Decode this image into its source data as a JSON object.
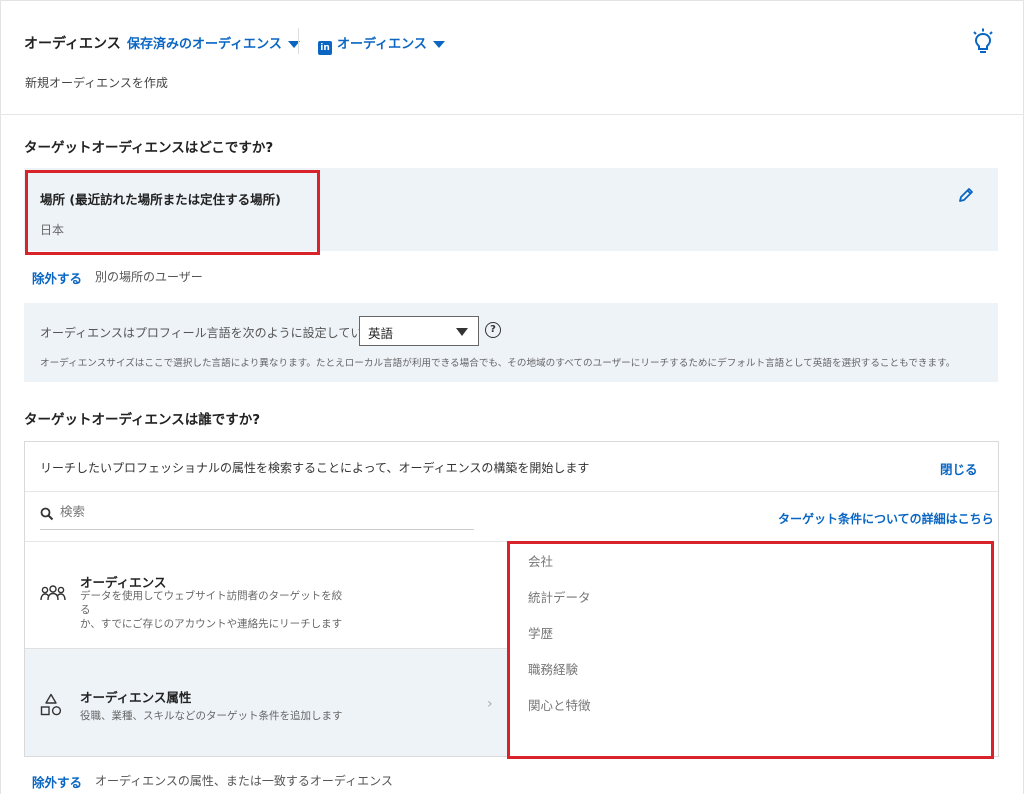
{
  "header": {
    "title": "オーディエンス",
    "saved_dropdown": "保存済みのオーディエンス",
    "linkedin_dropdown": "オーディエンス",
    "linkedin_logo": "in",
    "new_audience": "新規オーディエンスを作成"
  },
  "location": {
    "heading": "ターゲットオーディエンスはどこですか?",
    "title": "場所 (最近訪れた場所または定住する場所)",
    "value": "日本",
    "exclude_label": "除外する",
    "exclude_desc": "別の場所のユーザー"
  },
  "language": {
    "text": "オーディエンスはプロフィール言語を次のように設定しています",
    "selected": "英語",
    "help": "?",
    "note": "オーディエンスサイズはここで選択した言語により異なります。たとえローカル言語が利用できる場合でも、その地域のすべてのユーザーにリーチするためにデフォルト言語として英語を選択することもできます。"
  },
  "who": {
    "heading": "ターゲットオーディエンスは誰ですか?",
    "intro": "リーチしたいプロフェッショナルの属性を検索することによって、オーディエンスの構築を開始します",
    "close": "閉じる",
    "search_placeholder": "検索",
    "details_link": "ターゲット条件についての詳細はこちら",
    "rows": [
      {
        "title": "オーディエンス",
        "desc_line1": "データを使用してウェブサイト訪問者のターゲットを絞る",
        "desc_line2": "か、すでにご存じのアカウントや連絡先にリーチします",
        "icon": "people-group-icon"
      },
      {
        "title": "オーディエンス属性",
        "desc": "役職、業種、スキルなどのターゲット条件を追加します",
        "icon": "shapes-icon",
        "chevron": "›"
      }
    ],
    "categories": [
      "会社",
      "統計データ",
      "学歴",
      "職務経験",
      "関心と特徴"
    ],
    "exclude_label": "除外する",
    "exclude_desc": "オーディエンスの属性、または一致するオーディエンス"
  },
  "colors": {
    "accent": "#0a66c2",
    "highlight": "#d8232a",
    "panel": "#eef3f8"
  }
}
